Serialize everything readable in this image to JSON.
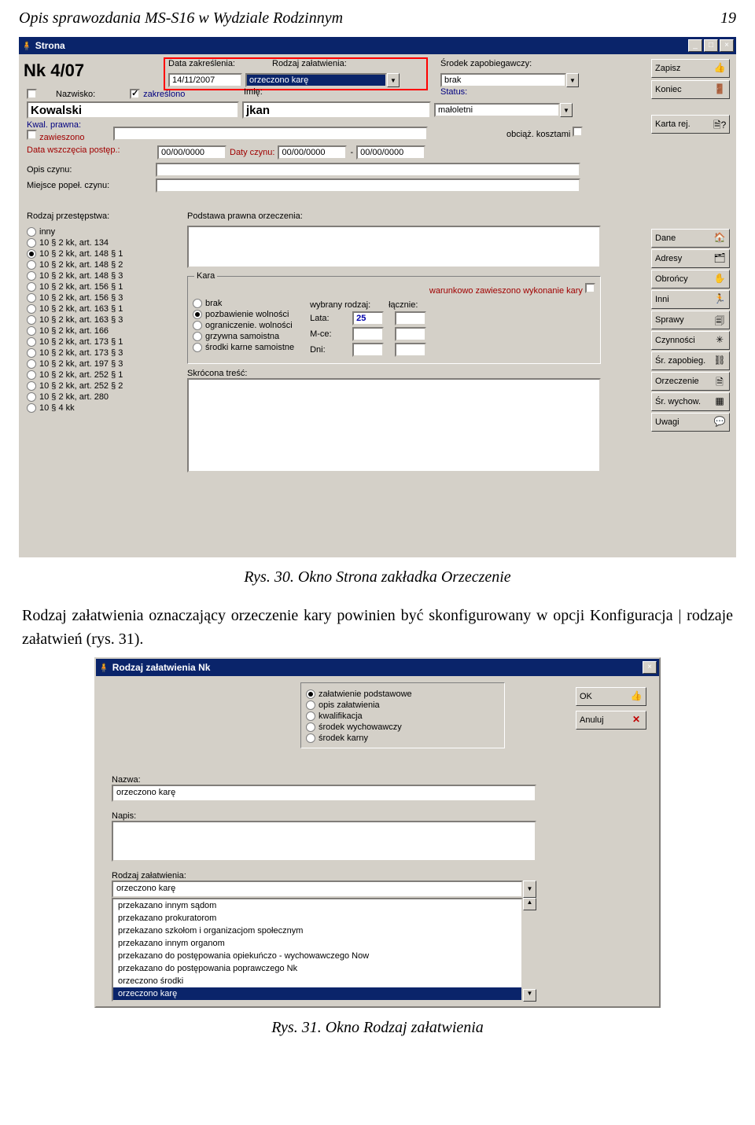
{
  "page_header": {
    "title": "Opis sprawozdania MS-S16 w Wydziale Rodzinnym",
    "page_no": "19"
  },
  "caption1": "Rys. 30. Okno Strona zakładka Orzeczenie",
  "paragraph": "Rodzaj załatwienia oznaczający orzeczenie kary powinien być skonfigurowany w opcji Konfiguracja | rodzaje załatwień (rys. 31).",
  "caption2": "Rys. 31. Okno Rodzaj załatwienia",
  "win1": {
    "title": "Strona",
    "case_no": "Nk 4/07",
    "labels": {
      "data_zakresl": "Data zakreślenia:",
      "rodzaj_zal": "Rodzaj załatwienia:",
      "srodek_zap": "Środek zapobiegawczy:",
      "nazwisko": "Nazwisko:",
      "zakreslono": "zakreślono",
      "imie": "Imię:",
      "status": "Status:",
      "kwal": "Kwal. prawna:",
      "zawieszono": "zawieszono",
      "obc": "obciąż. kosztami",
      "data_wszcz": "Data wszczęcia postęp.:",
      "daty_czynu": "Daty czynu:",
      "opis_czynu": "Opis czynu:",
      "miejsce": "Miejsce popeł. czynu:",
      "rodzaj_przest": "Rodzaj przestępstwa:",
      "podstawa": "Podstawa prawna orzeczenia:",
      "kara": "Kara",
      "war_zaw": "warunkowo zawieszono wykonanie kary",
      "wybrany": "wybrany rodzaj:",
      "lacznie": "łącznie:",
      "lata": "Lata:",
      "mce": "M-ce:",
      "dni": "Dni:",
      "skrocona": "Skrócona treść:"
    },
    "values": {
      "data_zakresl": "14/11/2007",
      "rodzaj_zal": "orzeczono karę",
      "srodek_zap": "brak",
      "nazwisko": "Kowalski",
      "imie": "jkan",
      "status": "małoletni",
      "date_zero": "00/00/0000",
      "lata": "25"
    },
    "przestepstwa": [
      "inny",
      "10 § 2 kk, art. 134",
      "10 § 2 kk, art. 148 § 1",
      "10 § 2 kk, art. 148 § 2",
      "10 § 2 kk, art. 148 § 3",
      "10 § 2 kk, art. 156 § 1",
      "10 § 2 kk, art. 156 § 3",
      "10 § 2 kk, art. 163 § 1",
      "10 § 2 kk, art. 163 § 3",
      "10 § 2 kk, art. 166",
      "10 § 2 kk, art. 173 § 1",
      "10 § 2 kk, art. 173 § 3",
      "10 § 2 kk, art. 197 § 3",
      "10 § 2 kk, art. 252 § 1",
      "10 § 2 kk, art. 252 § 2",
      "10 § 2 kk, art. 280",
      "10 § 4 kk"
    ],
    "przestepstwa_selected": 2,
    "kara_options": [
      "brak",
      "pozbawienie wolności",
      "ograniczenie. wolności",
      "grzywna samoistna",
      "środki karne samoistne"
    ],
    "kara_selected": 1,
    "right_top": [
      {
        "label": "Zapisz",
        "icon": "👍"
      },
      {
        "label": "Koniec",
        "icon": "🚪"
      },
      {
        "label": "Karta rej.",
        "icon": "🗎?"
      }
    ],
    "right_bottom": [
      {
        "label": "Dane",
        "icon": "🏠"
      },
      {
        "label": "Adresy",
        "icon": "🗂"
      },
      {
        "label": "Obrońcy",
        "icon": "✋"
      },
      {
        "label": "Inni",
        "icon": "🏃"
      },
      {
        "label": "Sprawy",
        "icon": "🗐"
      },
      {
        "label": "Czynności",
        "icon": "✳"
      },
      {
        "label": "Śr. zapobieg.",
        "icon": "⛓"
      },
      {
        "label": "Orzeczenie",
        "icon": "🗎"
      },
      {
        "label": "Śr. wychow.",
        "icon": "▦"
      },
      {
        "label": "Uwagi",
        "icon": "💬"
      }
    ]
  },
  "win2": {
    "title": "Rodzaj załatwienia Nk",
    "radios": [
      "załatwienie podstawowe",
      "opis załatwienia",
      "kwalifikacja",
      "środek wychowawczy",
      "środek karny"
    ],
    "radios_selected": 0,
    "labels": {
      "nazwa": "Nazwa:",
      "napis": "Napis:",
      "rodzaj": "Rodzaj załatwienia:"
    },
    "nazwa_value": "orzeczono karę",
    "rodzaj_value": "orzeczono karę",
    "list": [
      "przekazano innym sądom",
      "przekazano prokuratorom",
      "przekazano szkołom i organizacjom społecznym",
      "przekazano innym organom",
      "przekazano do postępowania opiekuńczo - wychowawczego Now",
      "przekazano do postępowania poprawczego Nk",
      "orzeczono środki",
      "orzeczono karę"
    ],
    "list_selected": 7,
    "buttons": {
      "ok": "OK",
      "anuluj": "Anuluj"
    }
  }
}
